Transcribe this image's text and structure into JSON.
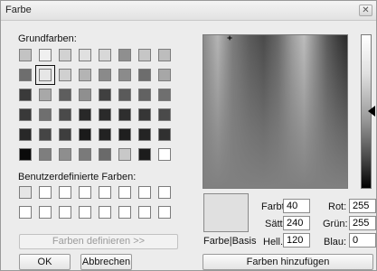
{
  "window": {
    "title": "Farbe"
  },
  "icons": {
    "close": "close-icon",
    "cursor": "crosshair-icon",
    "arrow": "luminance-arrow-icon"
  },
  "labels": {
    "basic_colors": "Grundfarben:",
    "custom_colors": "Benutzerdefinierte Farben:",
    "color_solid": "Farbe|Basis"
  },
  "basic_colors": [
    "#c3c3c3",
    "#f0f0f0",
    "#d2d2d2",
    "#e0e0e0",
    "#d8d8d8",
    "#8f8f8f",
    "#c6c6c6",
    "#bdbdbd",
    "#6e6e6e",
    "#e6e6e6",
    "#d0d0d0",
    "#b4b4b4",
    "#8a8a8a",
    "#8b8b8b",
    "#6d6d6d",
    "#a7a7a7",
    "#3a3a3a",
    "#a8a8a8",
    "#5e5e5e",
    "#8f8f8f",
    "#404040",
    "#5a5a5a",
    "#626262",
    "#6f6f6f",
    "#393939",
    "#6f6f6f",
    "#4a4a4a",
    "#282828",
    "#2a2a2a",
    "#2e2e2e",
    "#363636",
    "#4a4a4a",
    "#282828",
    "#454545",
    "#3e3e3e",
    "#1a1a1a",
    "#222222",
    "#1f1f1f",
    "#242424",
    "#303030",
    "#0a0a0a",
    "#7e7e7e",
    "#8e8e8e",
    "#7a7a7a",
    "#6a6a6a",
    "#c8c8c8",
    "#1c1c1c",
    "#ffffff"
  ],
  "selected_basic_index": 9,
  "custom_colors": [
    "#e6e6e6",
    "#ffffff",
    "#ffffff",
    "#ffffff",
    "#ffffff",
    "#ffffff",
    "#ffffff",
    "#ffffff",
    "#ffffff",
    "#ffffff",
    "#ffffff",
    "#ffffff",
    "#ffffff",
    "#ffffff",
    "#ffffff",
    "#ffffff"
  ],
  "buttons": {
    "define_custom": "Farben definieren >>",
    "ok": "OK",
    "cancel": "Abbrechen",
    "add_custom": "Farben hinzufügen"
  },
  "fields": {
    "hue": {
      "label": "Farbt.:",
      "value": "40"
    },
    "sat": {
      "label": "Sätt.:",
      "value": "240"
    },
    "lum": {
      "label": "Hell.:",
      "value": "120"
    },
    "red": {
      "label": "Rot:",
      "value": "255"
    },
    "green": {
      "label": "Grün:",
      "value": "255"
    },
    "blue": {
      "label": "Blau:",
      "value": "0"
    }
  },
  "preview_color": "#e0e0e0"
}
